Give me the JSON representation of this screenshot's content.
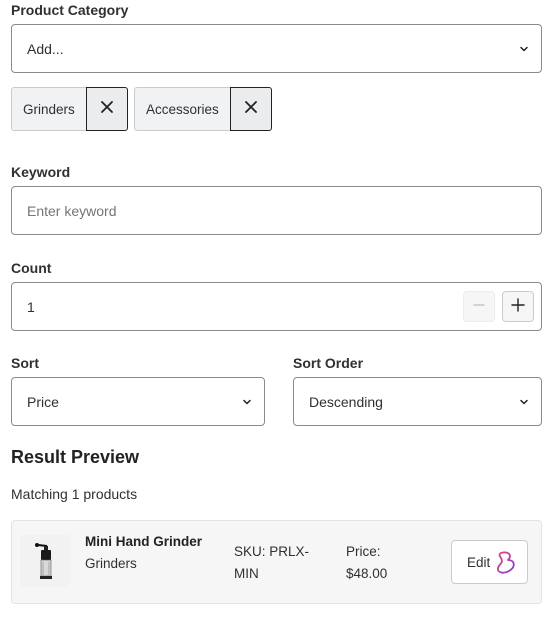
{
  "product_category": {
    "label": "Product Category",
    "select_value": "Add...",
    "tags": [
      {
        "label": "Grinders"
      },
      {
        "label": "Accessories"
      }
    ]
  },
  "keyword": {
    "label": "Keyword",
    "placeholder": "Enter keyword"
  },
  "count": {
    "label": "Count",
    "value": "1"
  },
  "sort": {
    "label": "Sort",
    "value": "Price"
  },
  "sort_order": {
    "label": "Sort Order",
    "value": "Descending"
  },
  "result_preview": {
    "heading": "Result Preview",
    "summary": "Matching 1 products",
    "items": [
      {
        "name": "Mini Hand Grinder",
        "category": "Grinders",
        "sku_label": "SKU: PRLX-",
        "sku_rest": "MIN",
        "price_label": "Price:",
        "price_value": "$48.00",
        "edit_label": "Edit"
      }
    ]
  },
  "icons": {
    "select_chevron": "chevron-down-icon",
    "remove_tag": "close-icon",
    "decrement": "minus-icon",
    "increment": "plus-icon",
    "edit_logo": "app-logo-icon"
  },
  "colors": {
    "border": "#8a8a8a",
    "text": "#303030",
    "logo_gradient_start": "#e8417a",
    "logo_gradient_end": "#7a3fd1"
  }
}
